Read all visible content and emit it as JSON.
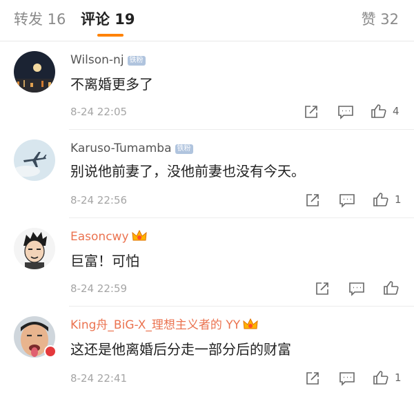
{
  "tabs": {
    "repost_label": "转发 16",
    "comment_label": "评论 19",
    "like_label": "赞 32",
    "accent_color": "#ff8200"
  },
  "comments": [
    {
      "username": "Wilson-nj",
      "badge": "铁粉",
      "text": "不离婚更多了",
      "time": "8-24 22:05",
      "like_count": "4",
      "avatar": "night-moon-avatar"
    },
    {
      "username": "Karuso-Tumamba",
      "badge": "铁粉",
      "text": "别说他前妻了，没他前妻也没有今天。",
      "time": "8-24 22:56",
      "like_count": "1",
      "avatar": "airplane-sky-avatar"
    },
    {
      "username": "Easoncwy",
      "badge_icon": "crown-icon",
      "text": "巨富！可怕",
      "time": "8-24 22:59",
      "like_count": "",
      "avatar": "cartoon-face-avatar"
    },
    {
      "username": "King舟_BiG-X_理想主义者的 YY",
      "badge_icon": "crown-icon",
      "text": "这还是他离婚后分走一部分后的财富",
      "time": "8-24 22:41",
      "like_count": "1",
      "avatar": "man-tongue-avatar"
    }
  ],
  "colors": {
    "vip_name": "#eb7350",
    "plain_name": "#555555",
    "time": "#a5a5a5"
  }
}
